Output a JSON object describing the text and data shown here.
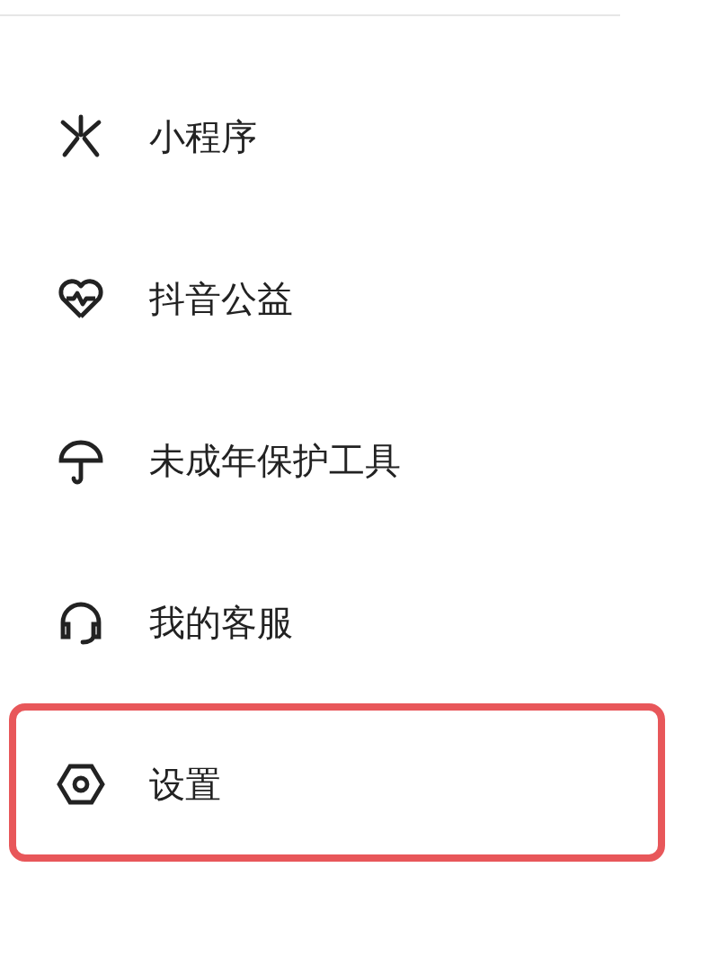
{
  "menu": {
    "items": [
      {
        "label": "小程序",
        "kind": "miniapp",
        "highlighted": false
      },
      {
        "label": "抖音公益",
        "kind": "charity",
        "highlighted": false
      },
      {
        "label": "未成年保护工具",
        "kind": "umbrella",
        "highlighted": false
      },
      {
        "label": "我的客服",
        "kind": "service",
        "highlighted": false
      },
      {
        "label": "设置",
        "kind": "settings",
        "highlighted": true
      }
    ]
  }
}
